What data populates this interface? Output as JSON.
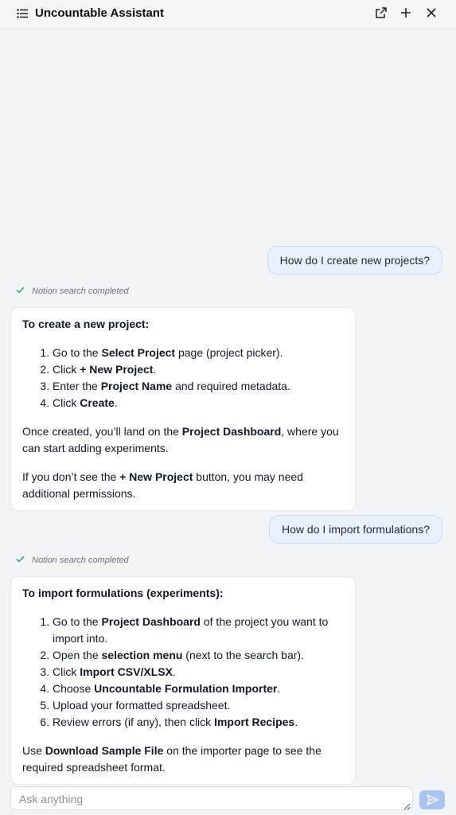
{
  "header": {
    "title": "Uncountable Assistant",
    "icons": [
      "list-icon",
      "external-link-icon",
      "plus-icon",
      "close-icon"
    ]
  },
  "messages": [
    {
      "role": "user",
      "text": "How do I create new projects?"
    },
    {
      "role": "tool",
      "text": "Notion search completed"
    },
    {
      "role": "assistant",
      "heading": "To create a new project:",
      "steps": [
        [
          "Go to the ",
          "Select Project",
          " page (project picker)."
        ],
        [
          "Click ",
          "+ New Project",
          "."
        ],
        [
          "Enter the ",
          "Project Name",
          " and required metadata."
        ],
        [
          "Click ",
          "Create",
          "."
        ]
      ],
      "para1": [
        "Once created, you’ll land on the ",
        "Project Dashboard",
        ", where you can start adding experiments."
      ],
      "para2": [
        "If you don’t see the ",
        "+ New Project",
        " button, you may need additional permissions."
      ]
    },
    {
      "role": "user",
      "text": "How do I import formulations?"
    },
    {
      "role": "tool",
      "text": "Notion search completed"
    },
    {
      "role": "assistant",
      "heading": "To import formulations (experiments):",
      "steps": [
        [
          "Go to the ",
          "Project Dashboard",
          " of the project you want to import into."
        ],
        [
          "Open the ",
          "selection menu",
          " (next to the search bar)."
        ],
        [
          "Click ",
          "Import CSV/XLSX",
          "."
        ],
        [
          "Choose ",
          "Uncountable Formulation Importer",
          "."
        ],
        [
          "Upload your formatted spreadsheet.",
          "",
          ""
        ],
        [
          "Review errors (if any), then click ",
          "Import Recipes",
          "."
        ]
      ],
      "para1": [
        "Use ",
        "Download Sample File",
        " on the importer page to see the required spreadsheet format."
      ]
    }
  ],
  "composer": {
    "placeholder": "Ask anything",
    "value": ""
  },
  "colors": {
    "background": "#f3f4f6",
    "user_bubble": "#e8f0fb",
    "send_button": "#a9c4f0",
    "check": "#22a55a"
  }
}
